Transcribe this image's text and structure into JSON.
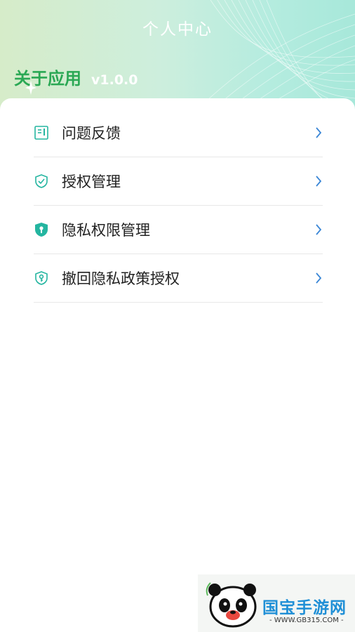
{
  "header": {
    "title": "个人中心",
    "about_title": "关于应用",
    "version": "v1.0.0"
  },
  "menu": {
    "items": [
      {
        "label": "问题反馈",
        "icon": "feedback-document-icon"
      },
      {
        "label": "授权管理",
        "icon": "shield-check-icon"
      },
      {
        "label": "隐私权限管理",
        "icon": "shield-lock-icon"
      },
      {
        "label": "撤回隐私政策授权",
        "icon": "shield-key-icon"
      }
    ]
  },
  "watermark": {
    "brand": "国宝手游网",
    "url": "- WWW.GB315.COM -"
  },
  "colors": {
    "accent": "#2aa854",
    "icon_teal": "#24b5a0",
    "chevron": "#3a86d6"
  }
}
